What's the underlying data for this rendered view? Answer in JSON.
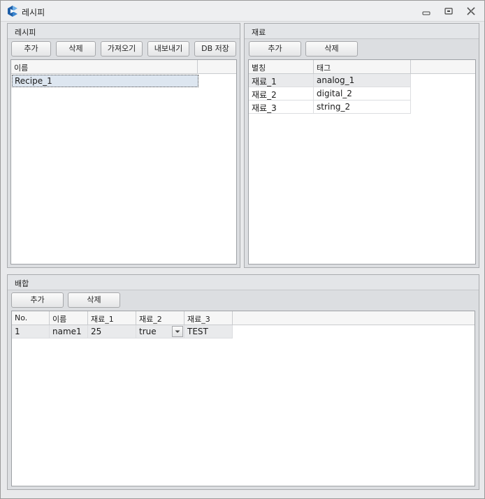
{
  "window": {
    "title": "레시피"
  },
  "recipe_panel": {
    "title": "레시피",
    "buttons": {
      "add": "추가",
      "delete": "삭제",
      "import": "가져오기",
      "export": "내보내기",
      "db_save": "DB 저장"
    },
    "column_header": "이름",
    "items": [
      "Recipe_1"
    ]
  },
  "material_panel": {
    "title": "재료",
    "buttons": {
      "add": "추가",
      "delete": "삭제"
    },
    "columns": [
      "별칭",
      "태그"
    ],
    "rows": [
      {
        "alias": "재료_1",
        "tag": "analog_1"
      },
      {
        "alias": "재료_2",
        "tag": "digital_2"
      },
      {
        "alias": "재료_3",
        "tag": "string_2"
      }
    ]
  },
  "mix_panel": {
    "title": "배합",
    "buttons": {
      "add": "추가",
      "delete": "삭제"
    },
    "columns": [
      "No.",
      "이름",
      "재료_1",
      "재료_2",
      "재료_3"
    ],
    "rows": [
      {
        "no": "1",
        "name": "name1",
        "m1": "25",
        "m2": "true",
        "m3": "TEST"
      }
    ]
  },
  "colors": {
    "accent": "#2a7fd4",
    "selection": "#dde6f0"
  },
  "icons": {
    "app": "app-logo-icon",
    "minimize": "minimize-icon",
    "maximize": "maximize-icon",
    "close": "close-icon",
    "dropdown": "chevron-down-icon"
  }
}
